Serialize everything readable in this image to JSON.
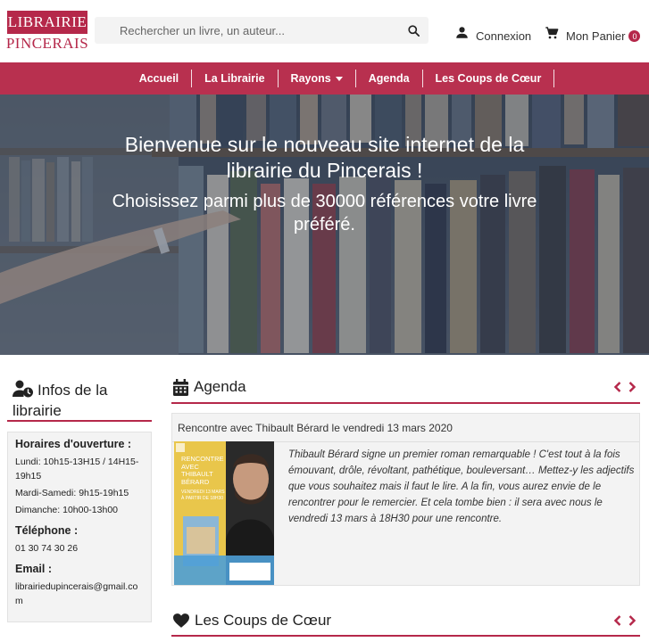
{
  "brand": {
    "logo_top": "LIBRAIRIE",
    "logo_bottom": "PINCERAIS",
    "accent": "#b5284a"
  },
  "search": {
    "placeholder": "Rechercher un livre, un auteur...",
    "icon": "search-icon"
  },
  "account": {
    "login_label": "Connexion",
    "login_icon": "user-icon",
    "cart_label": "Mon Panier",
    "cart_icon": "cart-icon",
    "cart_count": "0"
  },
  "nav": {
    "items": [
      {
        "label": "Accueil"
      },
      {
        "label": "La Librairie"
      },
      {
        "label": "Rayons"
      },
      {
        "label": "Agenda"
      },
      {
        "label": "Les Coups de Cœur"
      }
    ]
  },
  "hero": {
    "title": "Bienvenue sur le nouveau site internet de la librairie du Pincerais !",
    "subtitle": "Choisissez parmi plus de 30000 références votre livre préféré."
  },
  "infos": {
    "title": "Infos de la librairie",
    "icon": "user-clock-icon",
    "hours_heading": "Horaires d'ouverture :",
    "hours": [
      "Lundi: 10h15-13H15 / 14H15-19h15",
      "Mardi-Samedi: 9h15-19h15",
      "Dimanche: 10h00-13h00"
    ],
    "phone_heading": "Téléphone :",
    "phone": "01 30 74 30 26",
    "email_heading": "Email :",
    "email": "librairiedupincerais@gmail.com"
  },
  "agenda": {
    "title": "Agenda",
    "icon": "calendar-icon",
    "event": {
      "heading": "Rencontre avec Thibault Bérard le vendredi 13 mars 2020",
      "poster_line1": "RENCONTRE",
      "poster_line2": "AVEC",
      "poster_line3": "THIBAULT",
      "poster_line4": "BÉRARD",
      "poster_line5": "VENDREDI 13 MARS",
      "poster_line6": "À PARTIR DE 18H30",
      "description": "Thibault Bérard signe un premier roman remarquable ! C'est tout à la fois émouvant, drôle, révoltant, pathétique, bouleversant… Mettez-y les adjectifs que vous souhaitez mais il faut le lire. A la fin, vous aurez envie de le rencontrer pour le remercier. Et cela tombe bien : il sera avec nous le vendredi 13 mars à 18H30 pour une rencontre."
    }
  },
  "coups": {
    "title": "Les Coups de Cœur",
    "icon": "heart-icon"
  }
}
